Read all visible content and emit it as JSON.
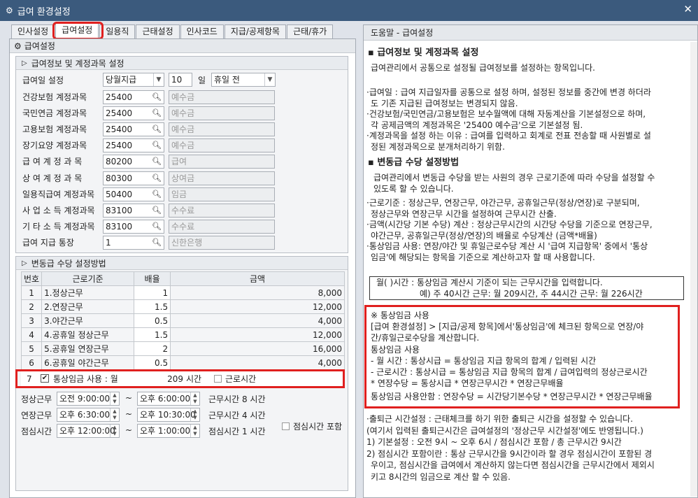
{
  "window": {
    "title": "급여 환경설정",
    "close": "✕"
  },
  "tabs": [
    "인사설정",
    "급여설정",
    "일용직",
    "근태설정",
    "인사코드",
    "지급/공제항목",
    "근태/휴가"
  ],
  "panel_title": "급여설정",
  "group1": {
    "title": "급여정보 및 계정과목 설정",
    "payday": {
      "label": "급여일 설정",
      "type": "당월지급",
      "day": "10",
      "unit": "일",
      "when": "휴일 전"
    },
    "accounts": [
      {
        "label": "건강보험 계정과목",
        "code": "25400",
        "name": "예수금"
      },
      {
        "label": "국민연금 계정과목",
        "code": "25400",
        "name": "예수금"
      },
      {
        "label": "고용보험 계정과목",
        "code": "25400",
        "name": "예수금"
      },
      {
        "label": "장기요양 계정과목",
        "code": "25400",
        "name": "예수금"
      },
      {
        "label": "급 여 계 정 과 목",
        "code": "80200",
        "name": "급여"
      },
      {
        "label": "상 여 계 정 과 목",
        "code": "80300",
        "name": "상여금"
      },
      {
        "label": "일용직급여 계정과목",
        "code": "50400",
        "name": "임금"
      },
      {
        "label": "사 업 소 득 계정과목",
        "code": "83100",
        "name": "수수료"
      },
      {
        "label": "기 타 소 득 계정과목",
        "code": "83100",
        "name": "수수료"
      },
      {
        "label": "급여 지급 통장",
        "code": "1",
        "name": "신한은행"
      }
    ]
  },
  "group2": {
    "title": "변동급 수당 설정방법",
    "headers": [
      "번호",
      "근로기준",
      "배율",
      "금액"
    ],
    "rows": [
      {
        "no": "1",
        "name": "1.정상근무",
        "rate": "1",
        "amount": "8,000"
      },
      {
        "no": "2",
        "name": "2.연장근무",
        "rate": "1.5",
        "amount": "12,000"
      },
      {
        "no": "3",
        "name": "3.야간근무",
        "rate": "0.5",
        "amount": "4,000"
      },
      {
        "no": "4",
        "name": "4.공휴일 정상근무",
        "rate": "1.5",
        "amount": "12,000"
      },
      {
        "no": "5",
        "name": "5.공휴일 연장근무",
        "rate": "2",
        "amount": "16,000"
      },
      {
        "no": "6",
        "name": "6.공휴일 야간근무",
        "rate": "0.5",
        "amount": "4,000"
      }
    ],
    "row7": {
      "no": "7",
      "check_label": "통상임금 사용 : 월",
      "hours": "209",
      "unit": "시간",
      "work_label": "근로시간"
    }
  },
  "times": [
    {
      "label": "정상근무",
      "from": "오전 9:00:00",
      "to": "오후 6:00:00",
      "info": "근무시간  8 시간"
    },
    {
      "label": "연장근무",
      "from": "오후 6:30:00",
      "to": "오후 10:30:00",
      "info": "근무시간  4 시간"
    },
    {
      "label": "점심시간",
      "from": "오후 12:00:00",
      "to": "오후 1:00:00",
      "info": "점심시간  1 시간",
      "check": "점심시간 포함"
    }
  ],
  "tilde": "~",
  "help": {
    "title": "도움말 - 급여설정",
    "s1_title": "▪ 급여정보 및 계정과목 설정",
    "s1_desc": "급여관리에서 공통으로 설정될 급여정보를 설정하는 항목입니다.",
    "b1": [
      "·급여일 : 급여 지급일자를 공통으로 설정 하며, 설정된 정보를 중간에 변경 하더라",
      "도 기존 지급된 급여정보는 변경되지 않음.",
      "·건강보험/국민연금/고용보험은 보수월액에 대해 자동계산을 기본설정으로 하며,",
      "각 공제금액의 계정과목은 '25400 예수금'으로 기본설정 됨.",
      "·계정과목을 설정 하는 이유 : 급여를 입력하고 회계로 전표 전송할 때 사원별로 설",
      "정된 계정과목으로 분개처리하기 위함."
    ],
    "s2_title": "▪ 변동급 수당 설정방법",
    "s2_desc": [
      "급여관리에서 변동급 수당을 받는 사원의 경우 근로기준에 따라 수당을 설정할 수",
      "있도록 할 수 있습니다."
    ],
    "b2": [
      "·근로기준 : 정상근무, 연장근무, 야간근무, 공휴일근무(정상/연장)로 구분되며,",
      "정상근무와 연장근무 시간을 설정하여 근무시간 산출.",
      "·금액(시간당 기본 수당) 계산 : 정상근무시간의 시간당 수당을 기준으로 연장근무,",
      "야간근무, 공휴일근무(정상/연장)의 배율로 수당계산 (금액*배율)",
      "·통상임금 사용: 연장/야간 및 휴일근로수당 계산 시 '급여 지급항목' 중에서 '통상",
      "임금'에 해당되는 항목을 기준으로 계산하고자 할 때 사용합니다."
    ],
    "box1": [
      "월( )시간 : 통상임금 계산시 기준이 되는 근무시간을 입력합니다.",
      "예) 주 40시간 근무: 월 209시간, 주 44시간 근무: 월 226시간"
    ],
    "box2": [
      "※ 통상임금 사용",
      "[급여 환경설정] > [지급/공제 항목]에서'통상임금'에 체크된 항목으로 연장/야",
      "간/휴일근로수당을 계산합니다.",
      "통상임금 사용",
      "- 월 시간 : 통상시급 = 통상임금 지급 항목의 합계 / 입력된 시간",
      "- 근로시간 : 통상시급 = 통상임금 지급 항목의 합계 / 급여입력의 정상근로시간",
      "* 연장수당 = 통상시급 * 연장근무시간 * 연장근무배율",
      "통상임금 사용안함 : 연장수당 = 시간당기본수당 * 연장근무시간 * 연장근무배율"
    ],
    "b3": [
      "·출퇴근 시간설정 : 근태체크를 하기 위한 출퇴근 시간을 설정할 수 있습니다.",
      "(여기서 입력된 출퇴근시간은 급여설정의 '정상근무 시간설정'에도 반영됩니다.)",
      "1) 기본설정 : 오전 9시 ~ 오후 6시 / 점심시간 포함 / 총 근무시간 9시간",
      "2) 점심시간 포함이란 : 통상 근무시간을 9시간이라 할 경우 점심시간이 포함된 경",
      "우이고, 점심시간을 급여에서 계산하지 않는다면 점심시간을 근무시간에서 제외시",
      "키고 8시간의 임금으로 계산 할 수 있음."
    ]
  }
}
